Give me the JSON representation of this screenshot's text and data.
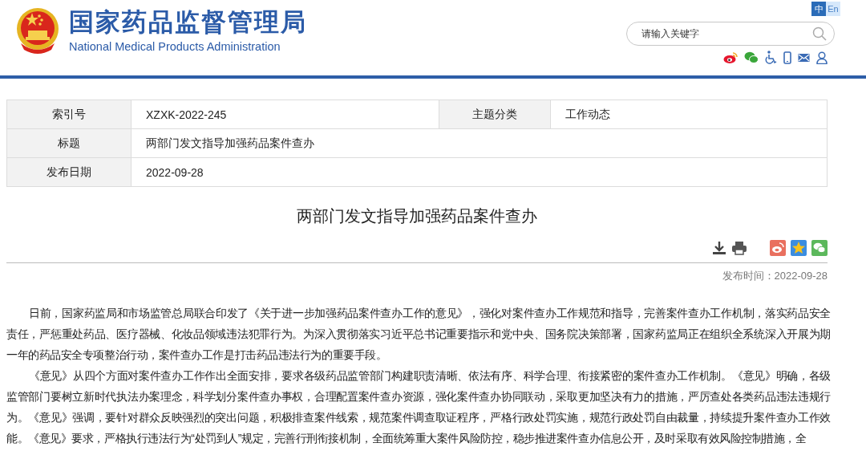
{
  "header": {
    "title_cn": "国家药品监督管理局",
    "title_en": "National Medical Products Administration",
    "languages": [
      {
        "label": "中",
        "selected": true
      },
      {
        "label": "En",
        "selected": false
      }
    ],
    "search": {
      "placeholder": "请输入关键字"
    }
  },
  "info_table": {
    "rows": [
      {
        "cells": [
          {
            "label": "索引号",
            "value": "XZXK-2022-245"
          },
          {
            "label": "主题分类",
            "value": "工作动态"
          }
        ]
      },
      {
        "cells": [
          {
            "label": "标题",
            "value": "两部门发文指导加强药品案件查办"
          }
        ]
      },
      {
        "cells": [
          {
            "label": "发布日期",
            "value": "2022-09-28"
          }
        ]
      }
    ]
  },
  "article": {
    "title": "两部门发文指导加强药品案件查办",
    "publish_time": "发布时间：2022-09-28",
    "paragraphs": [
      "日前，国家药监局和市场监管总局联合印发了《关于进一步加强药品案件查办工作的意见》，强化对案件查办工作规范和指导，完善案件查办工作机制，落实药品安全责任，严惩重处药品、医疗器械、化妆品领域违法犯罪行为。为深入贯彻落实习近平总书记重要指示和党中央、国务院决策部署，国家药监局正在组织全系统深入开展为期一年的药品安全专项整治行动，案件查办工作是打击药品违法行为的重要手段。",
      "《意见》从四个方面对案件查办工作作出全面安排，要求各级药品监管部门构建职责清晰、依法有序、科学合理、衔接紧密的案件查办工作机制。《意见》明确，各级监管部门要树立新时代执法办案理念，科学划分案件查办事权，合理配置案件查办资源，强化案件查办协同联动，采取更加坚决有力的措施，严厉查处各类药品违法违规行为。《意见》强调，要针对群众反映强烈的突出问题，积极排查案件线索，规范案件调查取证程序，严格行政处罚实施，规范行政处罚自由裁量，持续提升案件查办工作效能。《意见》要求，严格执行违法行为“处罚到人”规定，完善行刑衔接机制，全面统筹重大案件风险防控，稳步推进案件查办信息公开，及时采取有效风险控制措施，全"
    ]
  }
}
